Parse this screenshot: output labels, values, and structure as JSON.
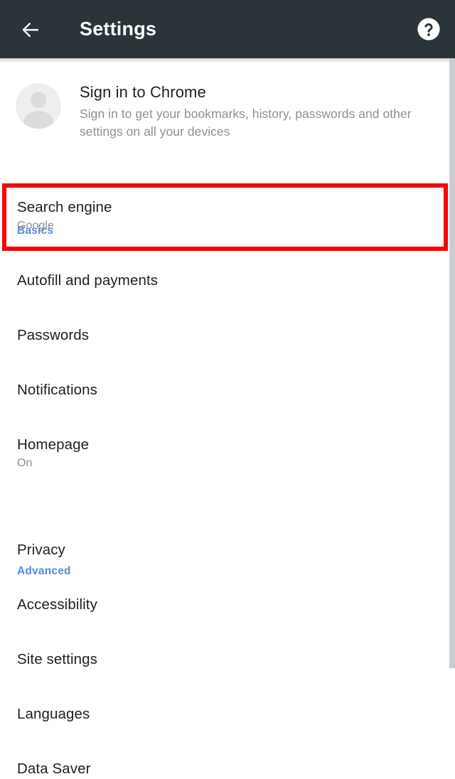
{
  "toolbar": {
    "back_icon": "arrow-left-icon",
    "title": "Settings",
    "help_icon": "help-circle-icon"
  },
  "signin_promo": {
    "avatar_icon": "person-avatar-icon",
    "title": "Sign in to Chrome",
    "subtitle": "Sign in to get your bookmarks, history, passwords and other settings on all your devices"
  },
  "sections": {
    "basics": {
      "label": "Basics",
      "items": [
        {
          "title": "Search engine",
          "subtitle": "Google",
          "highlighted": true
        },
        {
          "title": "Autofill and payments",
          "subtitle": ""
        },
        {
          "title": "Passwords",
          "subtitle": ""
        },
        {
          "title": "Notifications",
          "subtitle": ""
        },
        {
          "title": "Homepage",
          "subtitle": "On"
        }
      ]
    },
    "advanced": {
      "label": "Advanced",
      "items": [
        {
          "title": "Privacy",
          "subtitle": ""
        },
        {
          "title": "Accessibility",
          "subtitle": ""
        },
        {
          "title": "Site settings",
          "subtitle": ""
        },
        {
          "title": "Languages",
          "subtitle": ""
        },
        {
          "title": "Data Saver",
          "subtitle": ""
        }
      ]
    }
  },
  "annotation": {
    "target": "Search engine",
    "color": "#fb0303"
  },
  "colors": {
    "toolbar_bg": "#2b3539",
    "section_header": "#5b87e0",
    "primary_text": "#212121",
    "secondary_text": "#8d9194",
    "page_bg": "#ffffff",
    "scrollbar": "#c9cdcf"
  },
  "scrollbar": {
    "position": "right-edge",
    "state": "visible"
  }
}
